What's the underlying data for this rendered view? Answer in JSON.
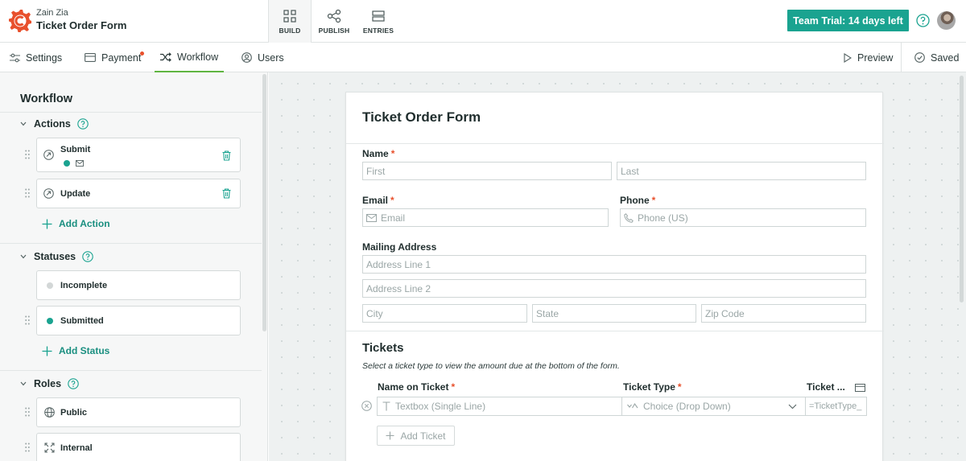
{
  "header": {
    "org_name": "Zain Zia",
    "app_name": "Ticket Order Form",
    "modes": [
      {
        "label": "BUILD",
        "icon": "build-grid-icon",
        "active": true
      },
      {
        "label": "PUBLISH",
        "icon": "share-icon",
        "active": false
      },
      {
        "label": "ENTRIES",
        "icon": "entries-icon",
        "active": false
      }
    ],
    "trial_label": "Team Trial: 14 days left",
    "colors": {
      "accent": "#1aa390",
      "brand": "#e8502c",
      "active_tab": "#5fb541"
    }
  },
  "subnav": {
    "tabs": [
      {
        "label": "Settings",
        "icon": "sliders-icon"
      },
      {
        "label": "Payment",
        "icon": "card-icon",
        "has_alert": true
      },
      {
        "label": "Workflow",
        "icon": "shuffle-icon",
        "active": true
      },
      {
        "label": "Users",
        "icon": "user-circle-icon"
      }
    ],
    "preview_label": "Preview",
    "saved_label": "Saved"
  },
  "sidebar": {
    "title": "Workflow",
    "actions": {
      "label": "Actions",
      "items": [
        {
          "label": "Submit"
        },
        {
          "label": "Update"
        }
      ],
      "add_label": "Add Action"
    },
    "statuses": {
      "label": "Statuses",
      "items": [
        {
          "label": "Incomplete",
          "color": "#d3d7d7"
        },
        {
          "label": "Submitted",
          "color": "#1aa390"
        }
      ],
      "add_label": "Add Status"
    },
    "roles": {
      "label": "Roles",
      "items": [
        {
          "label": "Public",
          "icon": "globe-icon"
        },
        {
          "label": "Internal",
          "icon": "internal-icon"
        }
      ]
    }
  },
  "form": {
    "title": "Ticket Order Form",
    "name_label": "Name",
    "first_placeholder": "First",
    "last_placeholder": "Last",
    "email_label": "Email",
    "email_placeholder": "Email",
    "phone_label": "Phone",
    "phone_placeholder": "Phone (US)",
    "address_label": "Mailing Address",
    "address1_placeholder": "Address Line 1",
    "address2_placeholder": "Address Line 2",
    "city_placeholder": "City",
    "state_placeholder": "State",
    "zip_placeholder": "Zip Code",
    "tickets": {
      "title": "Tickets",
      "subtitle": "Select a ticket type to view the amount due at the bottom of the form.",
      "columns": [
        "Name on Ticket",
        "Ticket Type",
        "Ticket ..."
      ],
      "row": {
        "name_field": "Textbox (Single Line)",
        "type_field": "Choice (Drop Down)",
        "formula_field": "=TicketType_"
      },
      "add_label": "Add Ticket"
    }
  }
}
